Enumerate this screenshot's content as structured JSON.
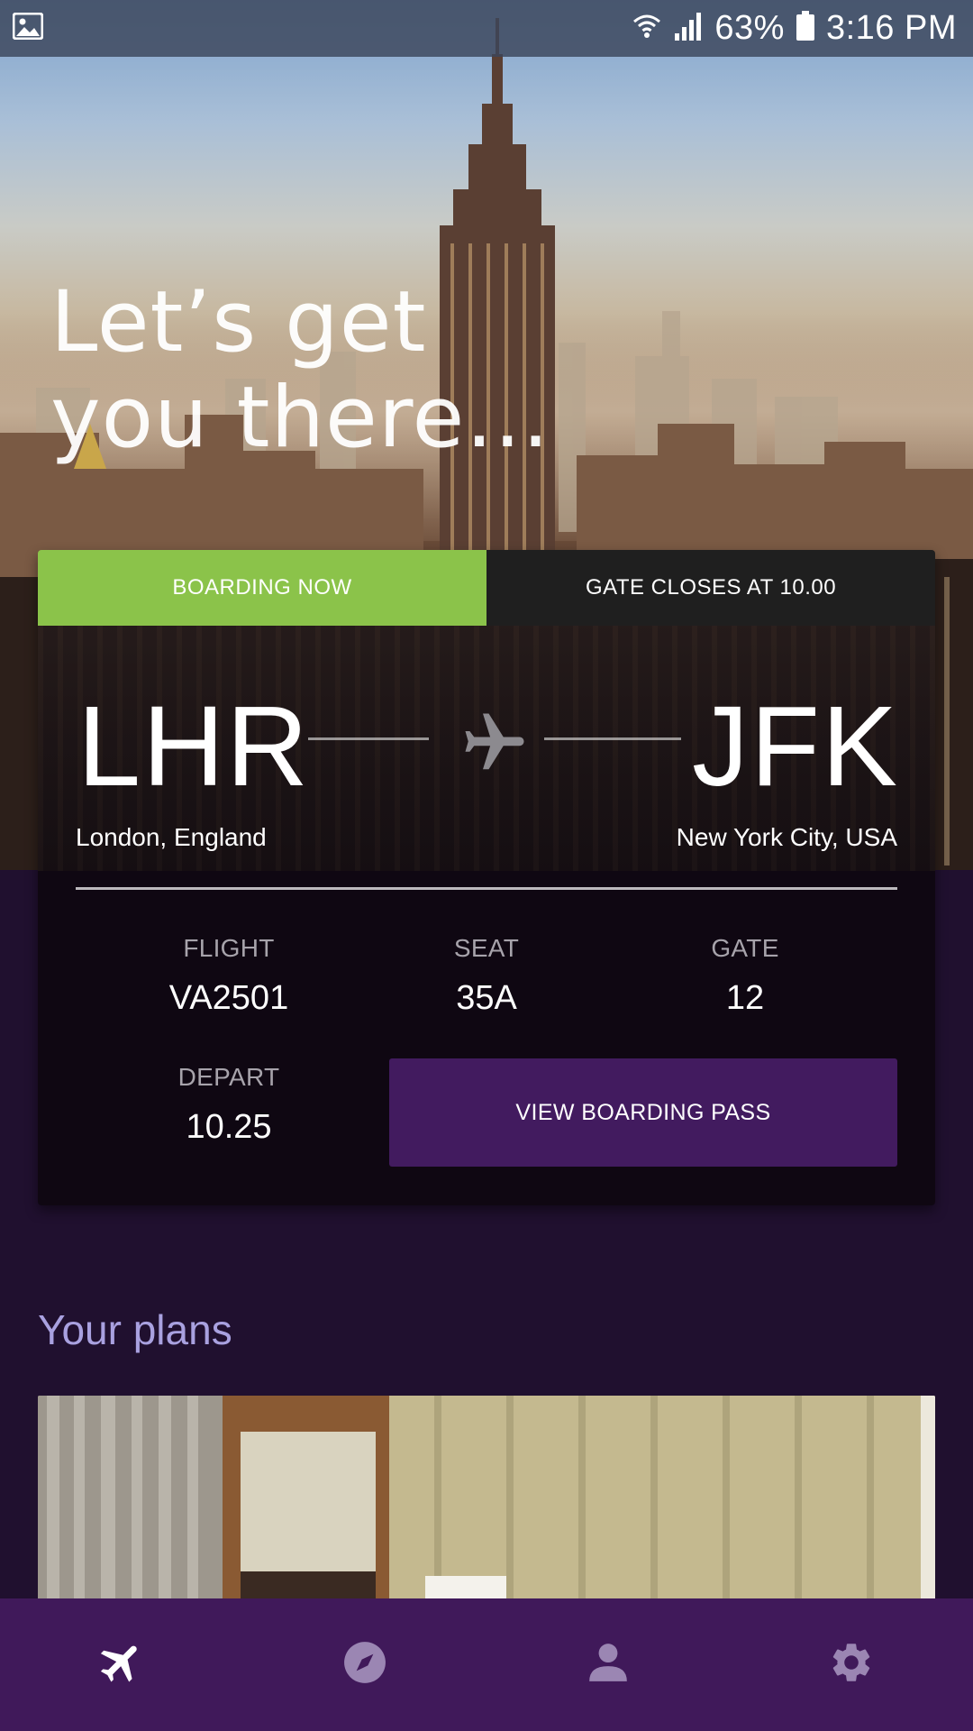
{
  "status_bar": {
    "battery": "63%",
    "time": "3:16 PM",
    "icons": [
      "gallery-icon",
      "wifi-icon",
      "signal-icon",
      "battery-icon"
    ]
  },
  "hero": {
    "headline": "Let’s get\nyou there…"
  },
  "flight_card": {
    "status_tab": "BOARDING NOW",
    "gate_tab": "GATE CLOSES AT 10.00",
    "origin": {
      "code": "LHR",
      "city": "London, England"
    },
    "destination": {
      "code": "JFK",
      "city": "New York City, USA"
    },
    "flight": {
      "label": "FLIGHT",
      "value": "VA2501"
    },
    "seat": {
      "label": "SEAT",
      "value": "35A"
    },
    "gate": {
      "label": "GATE",
      "value": "12"
    },
    "depart": {
      "label": "DEPART",
      "value": "10.25"
    },
    "boarding_pass_button": "VIEW BOARDING PASS"
  },
  "plans": {
    "title": "Your plans"
  },
  "bottom_nav": {
    "items": [
      {
        "icon": "flight-icon",
        "active": true
      },
      {
        "icon": "explore-icon",
        "active": false
      },
      {
        "icon": "profile-icon",
        "active": false
      },
      {
        "icon": "settings-icon",
        "active": false
      }
    ]
  },
  "colors": {
    "boarding_green": "#8bc34a",
    "gate_dark": "#1f1f1f",
    "button_purple": "#421b5f",
    "nav_purple": "#40195a",
    "page_bg": "#20102f",
    "plans_title": "#a9a1e0"
  }
}
